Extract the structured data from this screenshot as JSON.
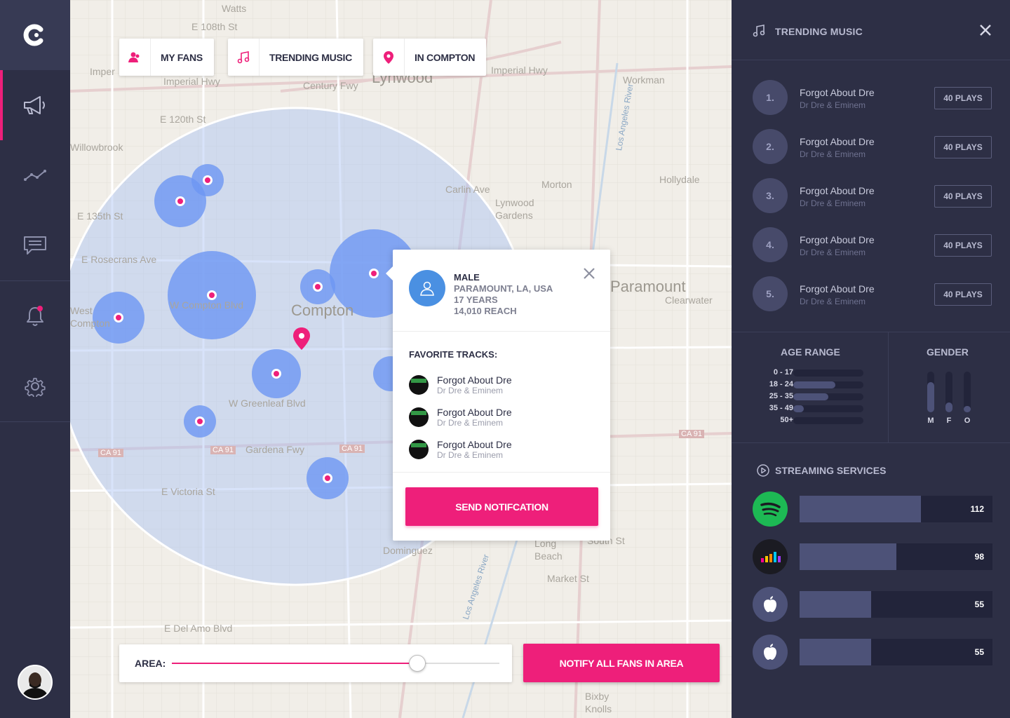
{
  "nav": {
    "items": [
      "campaigns",
      "analytics",
      "messages",
      "notifications",
      "settings"
    ]
  },
  "map": {
    "labels": {
      "watts": "Watts",
      "e108": "E 108th St",
      "imperial_hwy_left": "Imperial Hwy",
      "imperial_hwy_right": "Imperial Hwy",
      "imper": "Imper",
      "century": "Century Fwy",
      "lynwood": "Lynwood",
      "lynwood_gardens": "Lynwood Gardens",
      "e120": "E 120th St",
      "willowbrook": "Willowbrook",
      "e135": "E 135th St",
      "rosecrans": "E Rosecrans Ave",
      "compton": "Compton",
      "w_compton": "W Compton Blvd",
      "w_greenleaf": "W Greenleaf Blvd",
      "gardena": "Gardena Fwy",
      "e_victoria": "E Victoria St",
      "e_del_amo": "E Del Amo Blvd",
      "paramount": "Paramount",
      "clearwater": "Clearwater",
      "hollydale": "Hollydale",
      "morton": "Morton",
      "carlin": "Carlin Ave",
      "workman": "Workman",
      "market": "Market St",
      "south_st": "South St",
      "long_beach": "Long Beach",
      "dominguez": "Dominguez",
      "bixby": "Bixby Knolls",
      "la_river_1": "Los Angeles River",
      "la_river_2": "Los Angeles River",
      "ca91a": "CA 91",
      "ca91b": "CA 91",
      "ca91c": "CA 91",
      "ca91d": "CA 91",
      "west_compton": "West Compton"
    }
  },
  "chips": {
    "my_fans": "MY FANS",
    "trending_music": "TRENDING MUSIC",
    "location": "IN COMPTON"
  },
  "popup": {
    "gender": "MALE",
    "location": "PARAMOUNT, LA, USA",
    "age": "17 YEARS",
    "reach": "14,010 REACH",
    "favorite_title": "FAVORITE TRACKS:",
    "tracks": [
      {
        "name": "Forgot About Dre",
        "artist": "Dr Dre & Eminem"
      },
      {
        "name": "Forgot About Dre",
        "artist": "Dr Dre & Eminem"
      },
      {
        "name": "Forgot About Dre",
        "artist": "Dr Dre & Eminem"
      }
    ],
    "send_label": "SEND NOTIFCATION"
  },
  "area": {
    "label": "AREA:",
    "value": 0.75,
    "notify_label": "NOTIFY ALL FANS IN AREA"
  },
  "panel": {
    "title": "TRENDING MUSIC",
    "trending": [
      {
        "rank": "1.",
        "name": "Forgot About Dre",
        "artist": "Dr Dre & Eminem",
        "plays": "40 PLAYS"
      },
      {
        "rank": "2.",
        "name": "Forgot About Dre",
        "artist": "Dr Dre & Eminem",
        "plays": "40 PLAYS"
      },
      {
        "rank": "3.",
        "name": "Forgot About Dre",
        "artist": "Dr Dre & Eminem",
        "plays": "40 PLAYS"
      },
      {
        "rank": "4.",
        "name": "Forgot About Dre",
        "artist": "Dr Dre & Eminem",
        "plays": "40 PLAYS"
      },
      {
        "rank": "5.",
        "name": "Forgot About Dre",
        "artist": "Dr Dre & Eminem",
        "plays": "40 PLAYS"
      }
    ],
    "age_title": "AGE RANGE",
    "age_ranges": [
      {
        "label": "0 - 17",
        "fraction": 0.0
      },
      {
        "label": "18 - 24",
        "fraction": 0.6
      },
      {
        "label": "25 - 35",
        "fraction": 0.5
      },
      {
        "label": "35 - 49",
        "fraction": 0.15
      },
      {
        "label": "50+",
        "fraction": 0.0
      }
    ],
    "gender_title": "GENDER",
    "genders": [
      {
        "label": "M",
        "fraction": 0.75
      },
      {
        "label": "F",
        "fraction": 0.25
      },
      {
        "label": "O",
        "fraction": 0.15
      }
    ],
    "streaming_title": "STREAMING SERVICES",
    "streaming": [
      {
        "service": "spotify-icon",
        "value": "112",
        "fraction": 0.63,
        "color": "#1db954"
      },
      {
        "service": "deezer-icon",
        "value": "98",
        "fraction": 0.5,
        "color": "#1b1b22"
      },
      {
        "service": "apple-icon",
        "value": "55",
        "fraction": 0.37,
        "color": "#4d5278"
      },
      {
        "service": "apple-icon",
        "value": "55",
        "fraction": 0.37,
        "color": "#4d5278"
      }
    ]
  },
  "colors": {
    "accent": "#ee1f7a",
    "nav_bg": "#2d2f45",
    "circle_fill": "#6d96f2"
  }
}
